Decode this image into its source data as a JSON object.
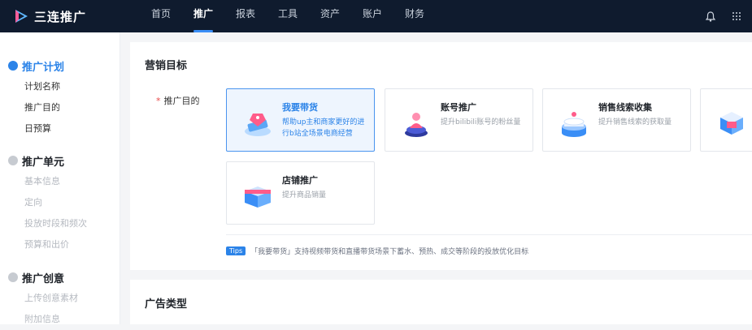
{
  "app": {
    "logo_text": "三连推广"
  },
  "nav": {
    "items": [
      {
        "label": "首页",
        "active": false
      },
      {
        "label": "推广",
        "active": true
      },
      {
        "label": "报表",
        "active": false
      },
      {
        "label": "工具",
        "active": false
      },
      {
        "label": "资产",
        "active": false
      },
      {
        "label": "账户",
        "active": false
      },
      {
        "label": "财务",
        "active": false
      }
    ]
  },
  "sidebar": {
    "groups": [
      {
        "title": "推广计划",
        "active": true,
        "items": [
          "计划名称",
          "推广目的",
          "日预算"
        ]
      },
      {
        "title": "推广单元",
        "active": false,
        "items": [
          "基本信息",
          "定向",
          "投放时段和频次",
          "预算和出价"
        ]
      },
      {
        "title": "推广创意",
        "active": false,
        "items": [
          "上传创意素材",
          "附加信息"
        ]
      }
    ]
  },
  "marketing": {
    "title": "营销目标",
    "purpose_label": "推广目的",
    "options": [
      {
        "title": "我要带货",
        "desc": "帮助up主和商家更好的进行b站全场景电商经营",
        "selected": true
      },
      {
        "title": "账号推广",
        "desc": "提升bilibili账号的粉丝量",
        "selected": false
      },
      {
        "title": "销售线索收集",
        "desc": "提升销售线索的获取量",
        "selected": false
      },
      {
        "title": "店铺推广",
        "desc": "提升商品销量",
        "selected": false
      }
    ],
    "tips_badge": "Tips",
    "tips_text": "「我要带货」支持视频带货和直播带货场景下蓄水、预热、成交等阶段的投放优化目标"
  },
  "ad_type": {
    "title": "广告类型"
  },
  "colors": {
    "accent": "#2b83e8",
    "topbar": "#0f1b2e"
  }
}
